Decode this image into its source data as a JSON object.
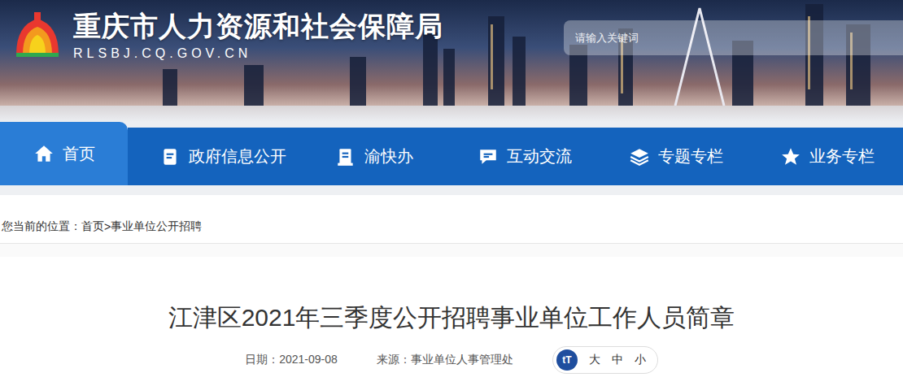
{
  "header": {
    "title": "重庆市人力资源和社会保障局",
    "domain": "RLSBJ.CQ.GOV.CN"
  },
  "search": {
    "placeholder": "请输入关键词"
  },
  "nav": [
    {
      "label": "首页",
      "selected": true
    },
    {
      "label": "政府信息公开",
      "selected": false
    },
    {
      "label": "渝快办",
      "selected": false
    },
    {
      "label": "互动交流",
      "selected": false
    },
    {
      "label": "专题专栏",
      "selected": false
    },
    {
      "label": "业务专栏",
      "selected": false
    }
  ],
  "breadcrumb": {
    "prefix": "您当前的位置：",
    "separator": ">",
    "items": [
      "首页",
      "事业单位公开招聘"
    ]
  },
  "article": {
    "title": "江津区2021年三季度公开招聘事业单位工作人员简章",
    "date": "日期：2021-09-08",
    "source": "来源：事业单位人事管理处",
    "font_icon": "tT",
    "font_sizes": [
      "大",
      "中",
      "小"
    ]
  }
}
